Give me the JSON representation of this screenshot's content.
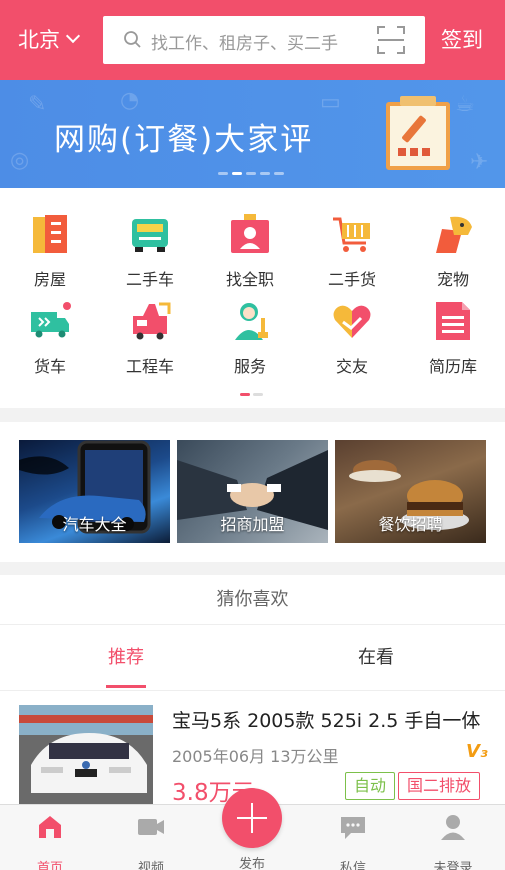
{
  "header": {
    "city": "北京",
    "search_placeholder": "找工作、租房子、买二手",
    "signin": "签到"
  },
  "banner": {
    "title": "网购(订餐)大家评"
  },
  "categories": [
    {
      "label": "房屋",
      "icon": "house-icon",
      "color": "#f25c3c"
    },
    {
      "label": "二手车",
      "icon": "used-car-icon",
      "color": "#2fc0a0"
    },
    {
      "label": "找全职",
      "icon": "fulltime-job-icon",
      "color": "#f24f6b"
    },
    {
      "label": "二手货",
      "icon": "shopping-cart-icon",
      "color": "#f25c3c"
    },
    {
      "label": "宠物",
      "icon": "pet-icon",
      "color": "#f25c3c"
    },
    {
      "label": "货车",
      "icon": "truck-icon",
      "color": "#2fc0a0"
    },
    {
      "label": "工程车",
      "icon": "engineering-vehicle-icon",
      "color": "#f24f6b"
    },
    {
      "label": "服务",
      "icon": "service-icon",
      "color": "#2fc0a0"
    },
    {
      "label": "交友",
      "icon": "friends-heart-icon",
      "color": "#f5b93a"
    },
    {
      "label": "简历库",
      "icon": "resume-icon",
      "color": "#f24f6b"
    }
  ],
  "promos": [
    {
      "label": "汽车大全"
    },
    {
      "label": "招商加盟"
    },
    {
      "label": "餐饮招聘"
    }
  ],
  "guess": {
    "heading": "猜你喜欢",
    "tabs": [
      {
        "label": "推荐"
      },
      {
        "label": "在看"
      }
    ]
  },
  "listing": {
    "title": "宝马5系 2005款 525i 2.5 手自一体",
    "meta": "2005年06月 13万公里",
    "badge": "V₃",
    "price": "3.8万元",
    "tags": [
      {
        "label": "自动",
        "color": "#7cc04a"
      },
      {
        "label": "国二排放",
        "color": "#f24f6b"
      }
    ]
  },
  "bottom_nav": [
    {
      "label": "首页",
      "icon": "home-icon"
    },
    {
      "label": "视频",
      "icon": "video-icon"
    },
    {
      "label": "发布",
      "icon": "plus-icon"
    },
    {
      "label": "私信",
      "icon": "message-icon"
    },
    {
      "label": "未登录",
      "icon": "user-icon"
    }
  ],
  "colors": {
    "accent": "#f24f6b",
    "banner": "#4d8de6"
  }
}
